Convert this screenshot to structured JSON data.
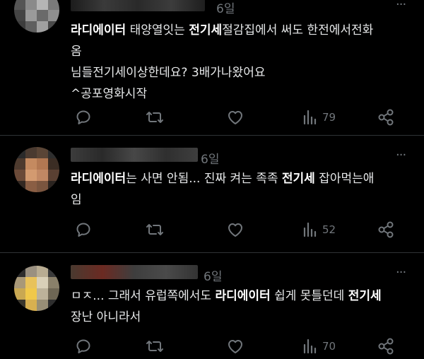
{
  "posts": [
    {
      "time": "6일",
      "more": "···",
      "text_parts": [
        {
          "t": "라디에이터",
          "b": true
        },
        {
          "t": " 태양열잇는 ",
          "b": false
        },
        {
          "t": "전기세",
          "b": true
        },
        {
          "t": "절감집에서 써도 한전에서전화",
          "b": false
        }
      ],
      "line2": "옴",
      "line3": "님들전기세이상한데요? 3배가나왔어요",
      "line4": "^공포영화시작",
      "views": "79"
    },
    {
      "time": "6일",
      "more": "···",
      "text_parts": [
        {
          "t": "라디에이터",
          "b": true
        },
        {
          "t": "는 사면 안됨... 진짜 켜는 족족 ",
          "b": false
        },
        {
          "t": "전기세",
          "b": true
        },
        {
          "t": " 잡아먹는애",
          "b": false
        }
      ],
      "line2": "임",
      "views": "52"
    },
    {
      "time": "6일",
      "more": "···",
      "text_parts": [
        {
          "t": "ㅁㅈ... 그래서 유럽쪽에서도 ",
          "b": false
        },
        {
          "t": "라디에이터",
          "b": true
        },
        {
          "t": " 쉽게 못틀던데 ",
          "b": false
        },
        {
          "t": "전기세",
          "b": true
        }
      ],
      "line2": "장난 아니라서",
      "views": "70"
    }
  ],
  "icons": [
    "reply-icon",
    "retweet-icon",
    "like-icon",
    "views-icon",
    "share-icon"
  ],
  "colors": {
    "background": "#000000",
    "text": "#e7e9ea",
    "muted": "#71767b",
    "divider": "#2f3336"
  }
}
